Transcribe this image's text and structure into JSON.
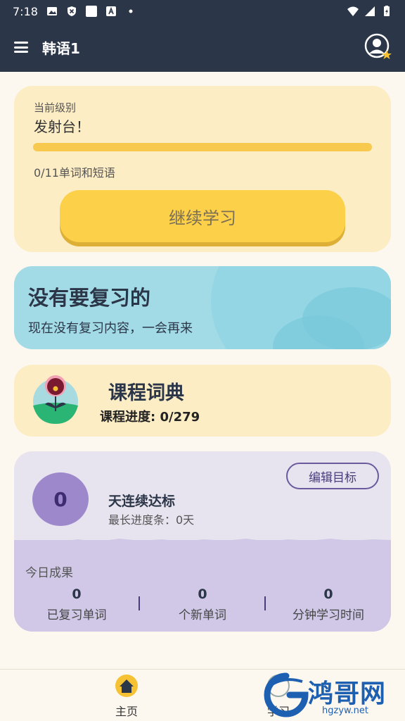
{
  "status_bar": {
    "time": "7:18"
  },
  "app_bar": {
    "title": "韩语1"
  },
  "level_card": {
    "label": "当前级别",
    "level_name": "发射台！",
    "progress_fraction": 0,
    "progress_text": "0/11单词和短语",
    "continue_label": "继续学习"
  },
  "review_card": {
    "title": "没有要复习的",
    "subtitle": "现在没有复习内容，一会再来"
  },
  "dictionary_card": {
    "title": "课程词典",
    "progress": "课程进度: 0/279"
  },
  "streak_card": {
    "streak_count": "0",
    "edit_goal_label": "编辑目标",
    "days_label": "天连续达标",
    "longest_label": "最长进度条：0天",
    "today_title": "今日成果",
    "stats": [
      {
        "value": "0",
        "label": "已复习单词"
      },
      {
        "value": "0",
        "label": "个新单词"
      },
      {
        "value": "0",
        "label": "分钟学习时间"
      }
    ]
  },
  "bottom_nav": {
    "items": [
      {
        "label": "主页",
        "icon": "home-icon"
      },
      {
        "label": "学习",
        "icon": "learn-icon"
      }
    ]
  },
  "watermark": {
    "text": "鸿哥网",
    "url": "hgzyw.net"
  },
  "colors": {
    "header": "#2b3648",
    "level_bg": "#fdedc5",
    "review_bg": "#a2dbe6",
    "streak_bg": "#e7e3ef",
    "accent_yellow": "#fdd049",
    "accent_purple": "#9e88cc"
  }
}
